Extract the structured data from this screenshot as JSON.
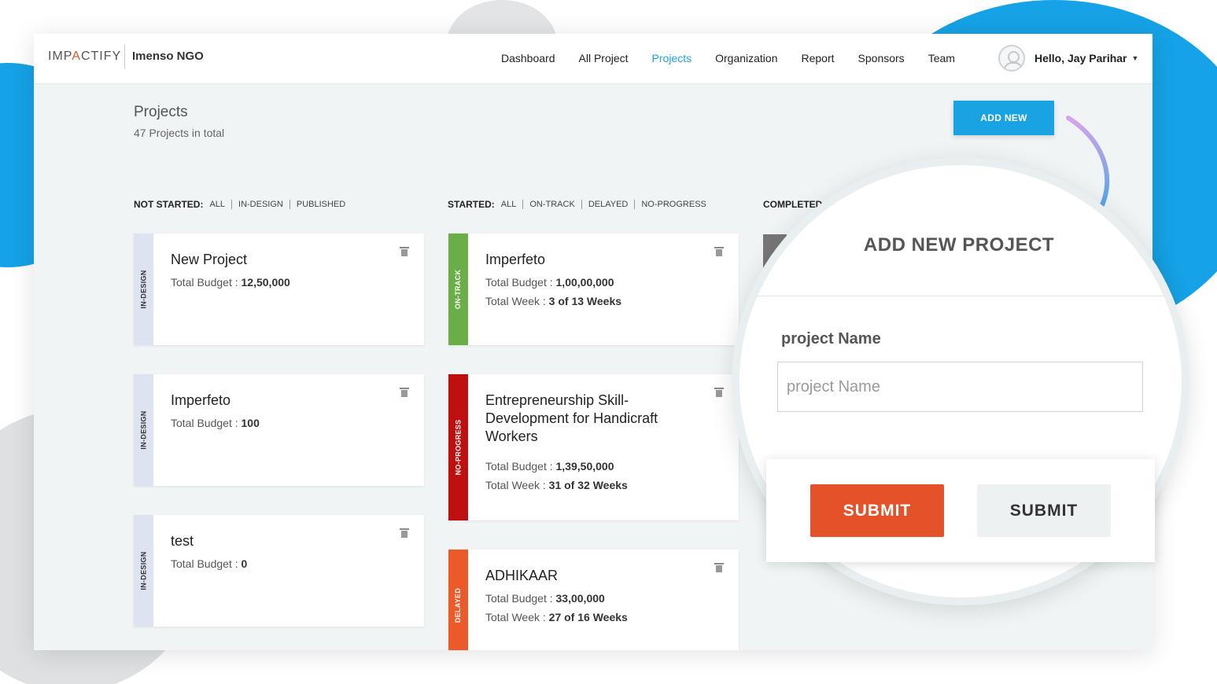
{
  "header": {
    "logo_prefix": "IMP",
    "logo_accent": "A",
    "logo_suffix": "CTIFY",
    "org_name": "Imenso NGO",
    "nav": [
      "Dashboard",
      "All Project",
      "Projects",
      "Organization",
      "Report",
      "Sponsors",
      "Team"
    ],
    "active_nav": "Projects",
    "user_greeting": "Hello, Jay Parihar"
  },
  "page": {
    "title": "Projects",
    "subtitle": "47 Projects in total",
    "add_new_label": "ADD NEW"
  },
  "filters": {
    "not_started": {
      "label": "NOT STARTED:",
      "options": [
        "ALL",
        "IN-DESIGN",
        "PUBLISHED"
      ]
    },
    "started": {
      "label": "STARTED:",
      "options": [
        "ALL",
        "ON-TRACK",
        "DELAYED",
        "NO-PROGRESS"
      ]
    },
    "completed": {
      "label": "COMPLETED"
    }
  },
  "cards": {
    "not_started": [
      {
        "status": "IN-DESIGN",
        "title": "New Project",
        "budget_label": "Total Budget :",
        "budget": "12,50,000"
      },
      {
        "status": "IN-DESIGN",
        "title": "Imperfeto",
        "budget_label": "Total Budget :",
        "budget": "100"
      },
      {
        "status": "IN-DESIGN",
        "title": "test",
        "budget_label": "Total Budget :",
        "budget": "0"
      }
    ],
    "started": [
      {
        "status": "ON-TRACK",
        "title": "Imperfeto",
        "budget_label": "Total Budget :",
        "budget": "1,00,00,000",
        "week_label": "Total Week :",
        "week": "3 of 13 Weeks"
      },
      {
        "status": "NO-PROGRESS",
        "title": "Entrepreneurship Skill-Development for Handicraft Workers",
        "budget_label": "Total Budget :",
        "budget": "1,39,50,000",
        "week_label": "Total Week :",
        "week": "31 of 32 Weeks"
      },
      {
        "status": "DELAYED",
        "title": "ADHIKAAR",
        "budget_label": "Total Budget :",
        "budget": "33,00,000",
        "week_label": "Total Week :",
        "week": "27 of 16 Weeks"
      }
    ]
  },
  "modal": {
    "title": "ADD NEW PROJECT",
    "field_label": "project Name",
    "field_placeholder": "project Name",
    "submit_primary": "SUBMIT",
    "submit_secondary": "SUBMIT"
  },
  "colors": {
    "accent_blue": "#1aa3e3",
    "on_track": "#6bae48",
    "no_progress": "#c00f0f",
    "delayed": "#ec5a2a",
    "submit": "#e4522a"
  }
}
